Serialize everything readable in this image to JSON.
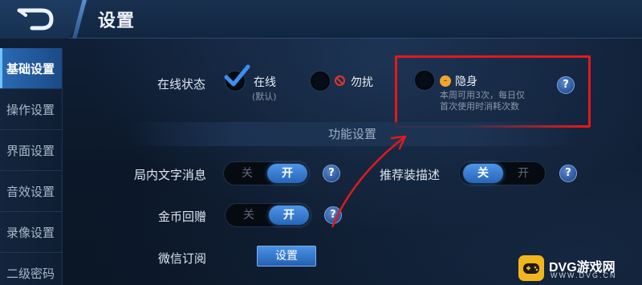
{
  "header": {
    "title": "设置"
  },
  "sidebar": {
    "items": [
      {
        "label": "基础设置",
        "active": true
      },
      {
        "label": "操作设置",
        "active": false
      },
      {
        "label": "界面设置",
        "active": false
      },
      {
        "label": "音效设置",
        "active": false
      },
      {
        "label": "录像设置",
        "active": false
      },
      {
        "label": "二级密码",
        "active": false
      }
    ]
  },
  "online_status": {
    "label": "在线状态",
    "options": [
      {
        "label": "在线",
        "sub": "(默认)",
        "selected": true
      },
      {
        "label": "勿扰",
        "selected": false
      },
      {
        "label": "隐身",
        "sub_line1": "本周可用3次，每日仅",
        "sub_line2": "首次使用时消耗次数",
        "selected": false
      }
    ]
  },
  "section": {
    "title": "功能设置"
  },
  "settings": {
    "in_game_text": {
      "label": "局内文字消息",
      "off": "关",
      "on": "开",
      "value": "开"
    },
    "recommend_equip": {
      "label": "推荐装描述",
      "off": "关",
      "on": "开",
      "value": "关"
    },
    "gold_gift": {
      "label": "金币回赠",
      "off": "关",
      "on": "开",
      "value": "开"
    },
    "wechat_sub": {
      "label": "微信订阅",
      "button": "设置"
    }
  },
  "help": {
    "symbol": "?"
  },
  "watermark": {
    "text": "DVG游戏网",
    "sub": "WWW.DVG.CN"
  },
  "colors": {
    "accent": "#2a6ab6",
    "highlight_box": "#e11a1a"
  }
}
